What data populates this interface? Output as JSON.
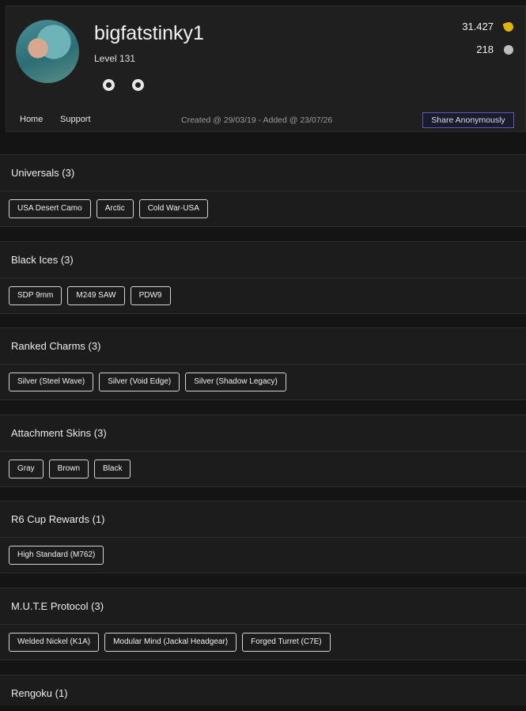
{
  "profile": {
    "username": "bigfatstinky1",
    "level": "Level 131",
    "coins": "31.427",
    "rank_points": "218",
    "created": "Created @ 29/03/19 - Added @ 23/07/26"
  },
  "nav": {
    "home": "Home",
    "support": "Support",
    "share": "Share Anonymously"
  },
  "sections": [
    {
      "title": "Universals (3)",
      "items": [
        "USA Desert Camo",
        "Arctic",
        "Cold War-USA"
      ]
    },
    {
      "title": "Black Ices (3)",
      "items": [
        "SDP 9mm",
        "M249 SAW",
        "PDW9"
      ]
    },
    {
      "title": "Ranked Charms (3)",
      "items": [
        "Silver (Steel Wave)",
        "Silver (Void Edge)",
        "Silver (Shadow Legacy)"
      ]
    },
    {
      "title": "Attachment Skins (3)",
      "items": [
        "Gray",
        "Brown",
        "Black"
      ]
    },
    {
      "title": "R6 Cup Rewards (1)",
      "items": [
        "High Standard (M762)"
      ]
    },
    {
      "title": "M.U.T.E Protocol (3)",
      "items": [
        "Welded Nickel (K1A)",
        "Modular Mind (Jackal Headgear)",
        "Forged Turret (C7E)"
      ]
    },
    {
      "title": "Rengoku (1)",
      "items": []
    }
  ],
  "colors": {
    "accent": "#5a57c8",
    "coin": "#e0b400"
  }
}
